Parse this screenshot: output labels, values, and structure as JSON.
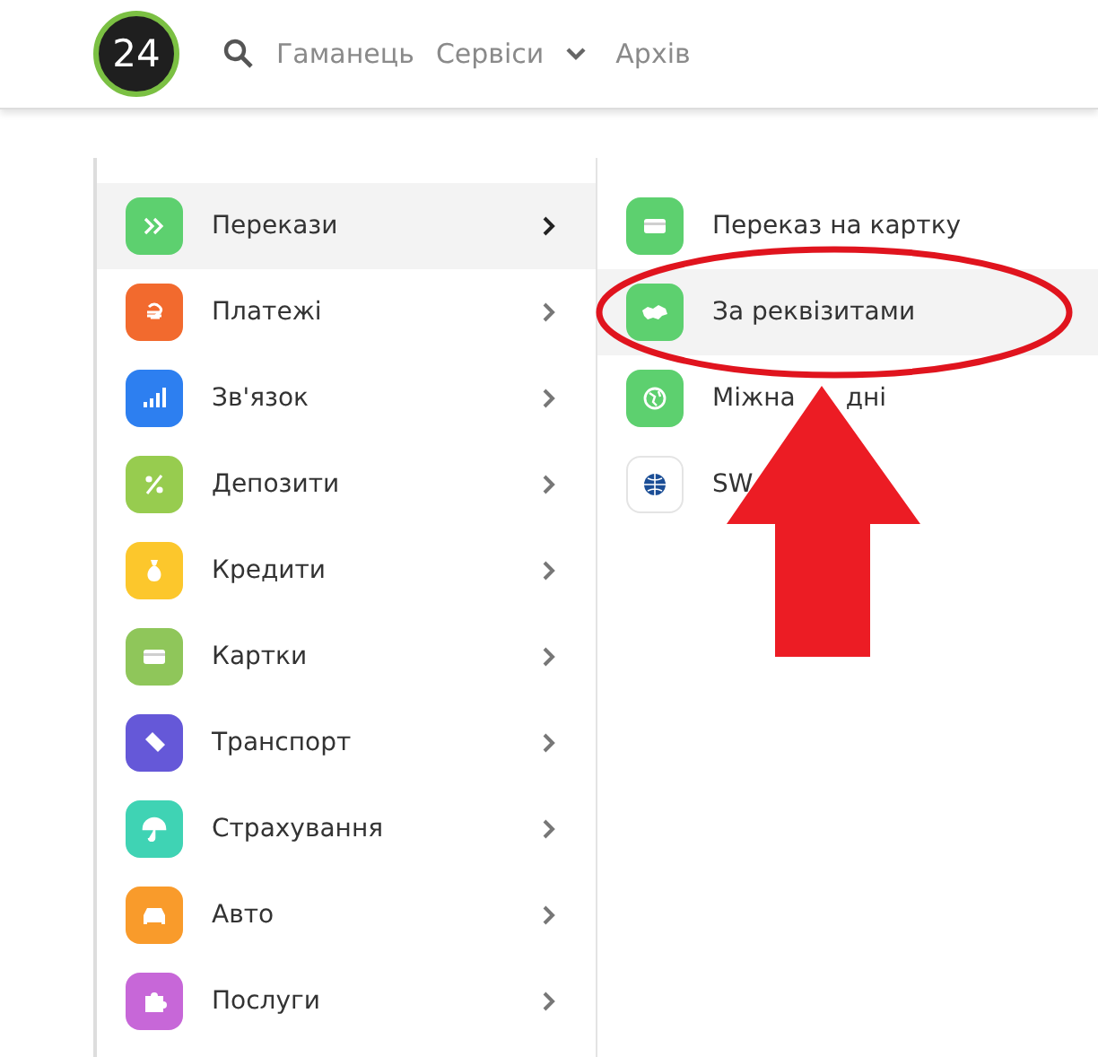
{
  "header": {
    "logo": "24",
    "nav": [
      {
        "label": "Гаманець",
        "kind": "link"
      },
      {
        "label": "Сервіси",
        "kind": "dropdown"
      },
      {
        "label": "Архів",
        "kind": "link"
      }
    ]
  },
  "menu": {
    "items": [
      {
        "label": "Перекази",
        "kind": "transfer",
        "color": "#5dd06f",
        "selected": true
      },
      {
        "label": "Платежі",
        "kind": "hryvnia",
        "color": "#f26a2e",
        "selected": false
      },
      {
        "label": "Зв'язок",
        "kind": "signal",
        "color": "#2d7ff0",
        "selected": false
      },
      {
        "label": "Депозити",
        "kind": "percent",
        "color": "#97cc4f",
        "selected": false
      },
      {
        "label": "Кредити",
        "kind": "bag",
        "color": "#fcc72c",
        "selected": false
      },
      {
        "label": "Картки",
        "kind": "card",
        "color": "#8fc65a",
        "selected": false
      },
      {
        "label": "Транспорт",
        "kind": "ticket",
        "color": "#6558d8",
        "selected": false
      },
      {
        "label": "Страхування",
        "kind": "umbrella",
        "color": "#3fd3b4",
        "selected": false
      },
      {
        "label": "Авто",
        "kind": "car",
        "color": "#f99b2b",
        "selected": false
      },
      {
        "label": "Послуги",
        "kind": "puzzle",
        "color": "#c767d8",
        "selected": false
      }
    ]
  },
  "submenu": {
    "items": [
      {
        "label": "Переказ на картку",
        "kind": "card",
        "color": "#5dd06f",
        "selected": false
      },
      {
        "label": "За реквізитами",
        "kind": "map",
        "color": "#5dd06f",
        "selected": true
      },
      {
        "label": "Міжна",
        "label_tail": "дні",
        "kind": "globe",
        "color": "#5dd06f",
        "selected": false
      },
      {
        "label": "SW",
        "kind": "swift",
        "color": "#ffffff",
        "selected": false
      }
    ]
  }
}
